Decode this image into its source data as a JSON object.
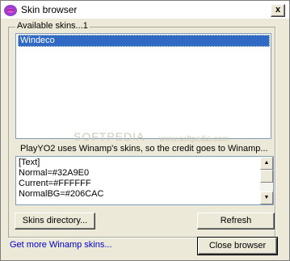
{
  "window": {
    "title": "Skin browser",
    "close_glyph": "x"
  },
  "skins_group": {
    "label": "Available skins...1",
    "items": [
      "Windeco"
    ],
    "selected_index": 0
  },
  "watermark": "SOFTPEDIA",
  "watermark_small": "www.softpedia.com",
  "info_text": "PlayYO2 uses Winamp's skins, so the credit goes to Winamp...",
  "skin_text": {
    "lines": [
      "[Text]",
      "Normal=#32A9E0",
      "Current=#FFFFFF",
      "NormalBG=#206CAC"
    ]
  },
  "buttons": {
    "skins_directory": "Skins directory...",
    "refresh": "Refresh",
    "close_browser": "Close browser"
  },
  "link": {
    "get_more": "Get more Winamp skins..."
  },
  "icons": {
    "app": "winamp-lips-icon",
    "scroll_up": "scroll-up-icon",
    "scroll_down": "scroll-down-icon"
  }
}
